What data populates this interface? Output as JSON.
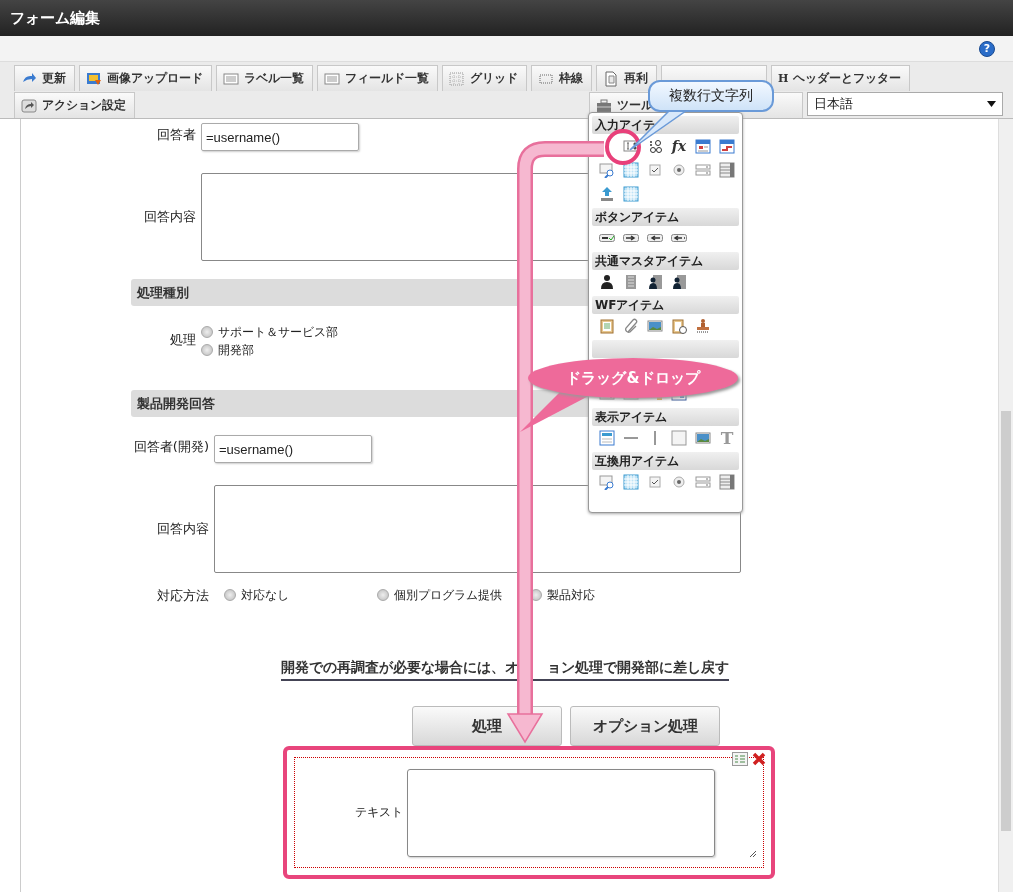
{
  "window": {
    "title": "フォーム編集"
  },
  "help": {
    "glyph": "?"
  },
  "toolbar": [
    {
      "items": [
        {
          "kind": "tab",
          "label": "更新"
        },
        {
          "kind": "tab",
          "label": "画像アップロード"
        },
        {
          "kind": "tab",
          "label": "ラベル一覧"
        },
        {
          "kind": "tab",
          "label": "フィールド一覧"
        },
        {
          "kind": "tab",
          "label": "グリッド"
        },
        {
          "kind": "tab",
          "label": "枠線"
        },
        {
          "kind": "tab",
          "label": "再利"
        },
        {
          "kind": "tab"
        },
        {
          "kind": "tab",
          "glyph": "H",
          "label": "ヘッダーとフッター"
        }
      ]
    },
    {
      "items": [
        {
          "kind": "tab",
          "label": "アクション設定"
        },
        {
          "kind": "spacer"
        },
        {
          "kind": "tab",
          "label": "ツール"
        },
        {
          "kind": "select",
          "value": "日本語"
        }
      ]
    }
  ],
  "form": [
    {
      "kind": "text",
      "label": "回答者",
      "value": "=username()"
    },
    {
      "kind": "textarea",
      "label": "回答内容"
    },
    {
      "kind": "section",
      "title": "処理種別"
    },
    {
      "kind": "radios-stacked",
      "label": "処理",
      "options": [
        {
          "label": "サポート＆サービス部",
          "selected": false
        },
        {
          "label": "開発部",
          "selected": false
        }
      ]
    },
    {
      "kind": "section",
      "title": "製品開発回答"
    },
    {
      "kind": "text",
      "label": "回答者(開発)",
      "value": "=username()"
    },
    {
      "kind": "textarea",
      "label": "回答内容"
    },
    {
      "kind": "radios-inline",
      "label": "対応方法",
      "options": [
        {
          "label": "対応なし",
          "selected": false
        },
        {
          "label": "個別プログラム提供",
          "selected": false
        },
        {
          "label": "製品対応",
          "selected": false
        }
      ]
    },
    {
      "kind": "note",
      "parts": [
        "開発での再調査が必要な場合には、オ",
        "ョン処理で開発部に差し戻す"
      ]
    },
    {
      "kind": "buttons",
      "buttons": [
        {
          "label": "処理"
        },
        {
          "label": "オプション処理"
        }
      ]
    }
  ],
  "dropped_item": {
    "label": "テキスト",
    "highlighted": true
  },
  "palette": {
    "sections": [
      {
        "title": "入力アイテ",
        "items": [
          {
            "kind": "blank"
          },
          {
            "kind": "multiline"
          },
          {
            "kind": "number"
          },
          {
            "kind": "formula",
            "glyph": "fx"
          },
          {
            "kind": "date"
          },
          {
            "kind": "daterange"
          },
          {
            "kind": "lookup"
          },
          {
            "kind": "grid"
          },
          {
            "kind": "check"
          },
          {
            "kind": "radio"
          },
          {
            "kind": "list"
          },
          {
            "kind": "listbox"
          },
          {
            "kind": "upload"
          },
          {
            "kind": "grid"
          }
        ]
      },
      {
        "title": "ボタンアイテム",
        "items": [
          {
            "kind": "btn-ok"
          },
          {
            "kind": "btn-next"
          },
          {
            "kind": "btn-back"
          },
          {
            "kind": "btn-back2"
          }
        ]
      },
      {
        "title": "共通マスタアイテム",
        "items": [
          {
            "kind": "person"
          },
          {
            "kind": "building"
          },
          {
            "kind": "person-building"
          },
          {
            "kind": "person-building"
          }
        ]
      },
      {
        "title": "WFアイテム",
        "items": [
          {
            "kind": "clipboard"
          },
          {
            "kind": "clip"
          },
          {
            "kind": "image"
          },
          {
            "kind": "clipboard-clock"
          },
          {
            "kind": "stamp"
          }
        ]
      },
      {
        "items": [
          {
            "kind": "blank"
          },
          {
            "kind": "blank"
          },
          {
            "kind": "blank"
          },
          {
            "kind": "blank"
          },
          {
            "kind": "blank"
          },
          {
            "kind": "blank"
          },
          {
            "kind": "field-small"
          },
          {
            "kind": "image-field"
          },
          {
            "kind": "folder"
          },
          {
            "kind": "grid-small"
          }
        ]
      },
      {
        "title": "表示アイテム",
        "items": [
          {
            "kind": "label"
          },
          {
            "kind": "hline"
          },
          {
            "kind": "vline"
          },
          {
            "kind": "frame"
          },
          {
            "kind": "image"
          },
          {
            "kind": "text-glyph",
            "glyph": "T"
          }
        ]
      },
      {
        "title": "互換用アイテム",
        "items": [
          {
            "kind": "lookup"
          },
          {
            "kind": "grid"
          },
          {
            "kind": "check"
          },
          {
            "kind": "radio"
          },
          {
            "kind": "list"
          },
          {
            "kind": "listbox"
          }
        ]
      }
    ]
  },
  "callouts": [
    {
      "kind": "tooltip",
      "text": "複数行文字列"
    },
    {
      "kind": "drag",
      "text": "ドラッグ&ドロップ"
    }
  ]
}
